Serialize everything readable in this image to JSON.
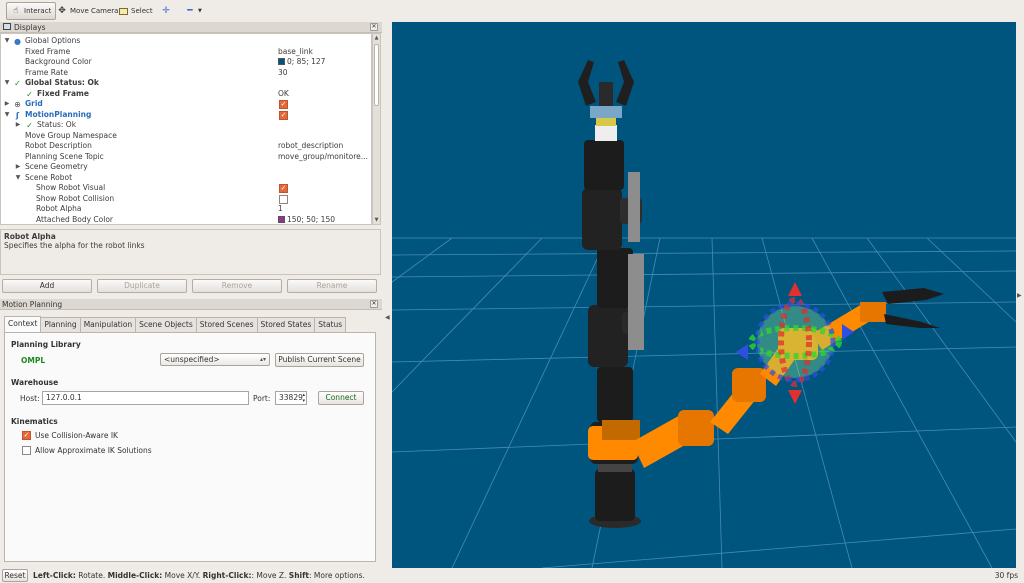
{
  "toolbar": {
    "interact": "Interact",
    "move_camera": "Move Camera",
    "select": "Select"
  },
  "displays": {
    "title": "Displays",
    "rows": [
      {
        "label": "Global Options",
        "value": ""
      },
      {
        "label": "Fixed Frame",
        "value": "base_link"
      },
      {
        "label": "Background Color",
        "value": "0; 85; 127"
      },
      {
        "label": "Frame Rate",
        "value": "30"
      },
      {
        "label": "Global Status: Ok",
        "value": ""
      },
      {
        "label": "Fixed Frame",
        "value": "OK"
      },
      {
        "label": "Grid",
        "value": ""
      },
      {
        "label": "MotionPlanning",
        "value": ""
      },
      {
        "label": "Status: Ok",
        "value": ""
      },
      {
        "label": "Move Group Namespace",
        "value": ""
      },
      {
        "label": "Robot Description",
        "value": "robot_description"
      },
      {
        "label": "Planning Scene Topic",
        "value": "move_group/monitore..."
      },
      {
        "label": "Scene Geometry",
        "value": ""
      },
      {
        "label": "Scene Robot",
        "value": ""
      },
      {
        "label": "Show Robot Visual",
        "value": ""
      },
      {
        "label": "Show Robot Collision",
        "value": ""
      },
      {
        "label": "Robot Alpha",
        "value": "1"
      },
      {
        "label": "Attached Body Color",
        "value": "150; 50; 150"
      }
    ],
    "colors": {
      "background_swatch": "#00557f",
      "attached_swatch": "#963296"
    },
    "checkboxes": {
      "grid": true,
      "motion_planning": true,
      "show_robot_visual": true,
      "show_robot_collision": false
    }
  },
  "description": {
    "title": "Robot Alpha",
    "text": "Specifies the alpha for the robot links"
  },
  "buttons": {
    "add": "Add",
    "duplicate": "Duplicate",
    "remove": "Remove",
    "rename": "Rename"
  },
  "motion_planning": {
    "title": "Motion Planning",
    "tabs": [
      "Context",
      "Planning",
      "Manipulation",
      "Scene Objects",
      "Stored Scenes",
      "Stored States",
      "Status"
    ],
    "active_tab": "Context",
    "planning_library": "Planning Library",
    "library_name": "OMPL",
    "planner_select": "<unspecified>",
    "publish_button": "Publish Current Scene",
    "warehouse": "Warehouse",
    "host_label": "Host:",
    "host_value": "127.0.0.1",
    "port_label": "Port:",
    "port_value": "33829",
    "connect_button": "Connect",
    "kinematics": "Kinematics",
    "collision_aware": "Use Collision-Aware IK",
    "collision_aware_checked": true,
    "approx_ik": "Allow Approximate IK Solutions",
    "approx_ik_checked": false
  },
  "viewport": {
    "background": "#00557f",
    "grid_color": "#5f9ec4",
    "robot_color": "#1c1c1c",
    "goal_arm_color": "#ff8a00"
  },
  "statusbar": {
    "reset": "Reset",
    "left_click": "Left-Click:",
    "left_action": " Rotate. ",
    "middle_click": "Middle-Click:",
    "middle_action": " Move X/Y. ",
    "right_click": "Right-Click:",
    "right_action": ": Move Z. ",
    "shift": "Shift",
    "shift_action": ": More options.",
    "fps": "30 fps"
  }
}
